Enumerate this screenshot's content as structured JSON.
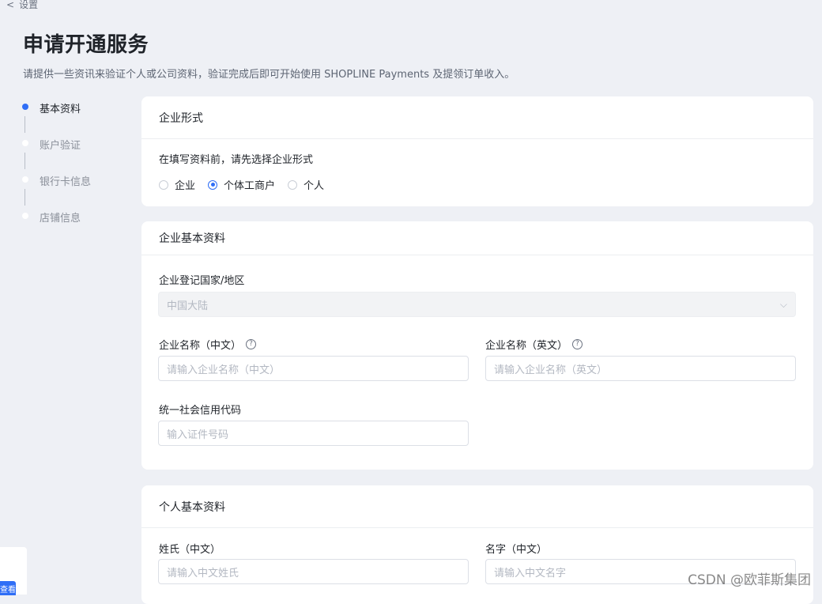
{
  "back": {
    "label": "设置"
  },
  "page": {
    "title": "申请开通服务",
    "subtitle": "请提供一些资讯来验证个人或公司资料，验证完成后即可开始使用 SHOPLINE Payments 及提领订单收入。"
  },
  "steps": [
    {
      "label": "基本资料",
      "active": true
    },
    {
      "label": "账户验证",
      "active": false
    },
    {
      "label": "银行卡信息",
      "active": false
    },
    {
      "label": "店铺信息",
      "active": false
    }
  ],
  "entity_form": {
    "title": "企业形式",
    "prompt": "在填写资料前，请先选择企业形式",
    "options": [
      {
        "label": "企业",
        "checked": false
      },
      {
        "label": "个体工商户",
        "checked": true
      },
      {
        "label": "个人",
        "checked": false
      }
    ]
  },
  "company_info": {
    "title": "企业基本资料",
    "country": {
      "label": "企业登记国家/地区",
      "value": "中国大陆"
    },
    "name_cn": {
      "label": "企业名称（中文）",
      "placeholder": "请输入企业名称（中文）"
    },
    "name_en": {
      "label": "企业名称（英文）",
      "placeholder": "请输入企业名称（英文）"
    },
    "credit_code": {
      "label": "统一社会信用代码",
      "placeholder": "输入证件号码"
    }
  },
  "personal_info": {
    "title": "个人基本资料",
    "surname": {
      "label": "姓氏（中文）",
      "placeholder": "请输入中文姓氏"
    },
    "given_name": {
      "label": "名字（中文）",
      "placeholder": "请输入中文名字"
    }
  },
  "side_button": {
    "label": "查看"
  },
  "watermark": "CSDN @欧菲斯集团",
  "colors": {
    "accent": "#2f6ef6",
    "background": "#eef0f5"
  }
}
